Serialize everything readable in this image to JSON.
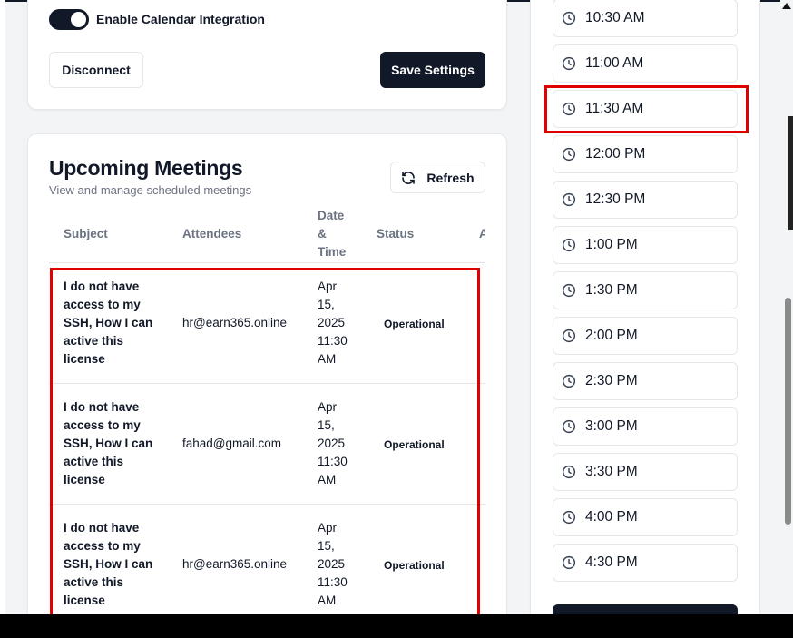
{
  "settings": {
    "integration_toggle_label": "Enable Calendar Integration",
    "integration_enabled": true,
    "disconnect_label": "Disconnect",
    "save_label": "Save Settings"
  },
  "meetings": {
    "title": "Upcoming Meetings",
    "subtitle": "View and manage scheduled meetings",
    "refresh_label": "Refresh",
    "columns": [
      "Subject",
      "Attendees",
      "Date & Time",
      "Status",
      "A"
    ],
    "rows": [
      {
        "subject": "I do not have access to my SSH, How I can active this license",
        "attendee": "hr@earn365.online",
        "datetime": "Apr 15, 2025 11:30 AM",
        "status": "Operational"
      },
      {
        "subject": "I do not have access to my SSH, How I can active this license",
        "attendee": "fahad@gmail.com",
        "datetime": "Apr 15, 2025 11:30 AM",
        "status": "Operational"
      },
      {
        "subject": "I do not have access to my SSH, How I can active this license",
        "attendee": "hr@earn365.online",
        "datetime": "Apr 15, 2025 11:30 AM",
        "status": "Operational"
      }
    ]
  },
  "time_slots": [
    "10:30 AM",
    "11:00 AM",
    "11:30 AM",
    "12:00 PM",
    "12:30 PM",
    "1:00 PM",
    "1:30 PM",
    "2:00 PM",
    "2:30 PM",
    "3:00 PM",
    "3:30 PM",
    "4:00 PM",
    "4:30 PM"
  ],
  "icons": {
    "clock": "clock-icon",
    "refresh": "refresh-icon"
  },
  "colors": {
    "primary": "#111827",
    "highlight": "#e00000",
    "muted_text": "#6b7280",
    "border": "#e5e7eb"
  }
}
